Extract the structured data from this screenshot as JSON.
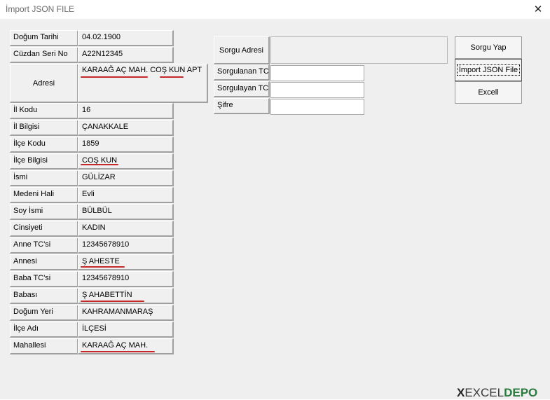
{
  "window": {
    "title": "İmport JSON FILE",
    "close_glyph": "✕"
  },
  "fields": [
    {
      "label": "Doğum Tarihi",
      "value": "04.02.1900"
    },
    {
      "label": "Cüzdan Seri No",
      "value": "A22N12345"
    },
    {
      "label": "Adresi",
      "value": "KARAAĞ    AÇ MAH. COŞ    KUN APT"
    },
    {
      "label": "İl Kodu",
      "value": "16"
    },
    {
      "label": "İl Bilgisi",
      "value": "ÇANAKKALE"
    },
    {
      "label": "İlçe Kodu",
      "value": "1859"
    },
    {
      "label": "İlçe Bilgisi",
      "value": "COŞ    KUN"
    },
    {
      "label": "İsmi",
      "value": "GÜLİZAR"
    },
    {
      "label": "Medeni Hali",
      "value": "Evli"
    },
    {
      "label": "Soy İsmi",
      "value": "BÜLBÜL"
    },
    {
      "label": "Cinsiyeti",
      "value": "KADIN"
    },
    {
      "label": "Anne TC'si",
      "value": "12345678910"
    },
    {
      "label": "Annesi",
      "value": "Ş    AHESTE"
    },
    {
      "label": "Baba TC'si",
      "value": "12345678910"
    },
    {
      "label": "Babası",
      "value": "Ş    AHABETTİN"
    },
    {
      "label": "Doğum Yeri",
      "value": "KAHRAMANMARAŞ"
    },
    {
      "label": "İlçe Adı",
      "value": "İLÇESİ"
    },
    {
      "label": "Mahallesi",
      "value": "KARAAĞ    AÇ MAH."
    }
  ],
  "query": {
    "sorgu_adresi_label": "Sorgu Adresi",
    "sorgu_adresi_value": "",
    "sorgulanan_tc_label": "Sorgulanan TC",
    "sorgulanan_tc_value": "",
    "sorgulayan_tc_label": "Sorgulayan TC",
    "sorgulayan_tc_value": "",
    "sifre_label": "Şifre",
    "sifre_value": ""
  },
  "buttons": {
    "sorgu_yap": "Sorgu Yap",
    "import_json": "İmport JSON File",
    "excell": "Excell"
  },
  "logo": {
    "x": "X",
    "excel": "EXCEL",
    "depo": "DEPO"
  },
  "colors": {
    "underline": "#c42828",
    "form_bg": "#f0f0f0",
    "logo_green": "#2b7a3e"
  }
}
